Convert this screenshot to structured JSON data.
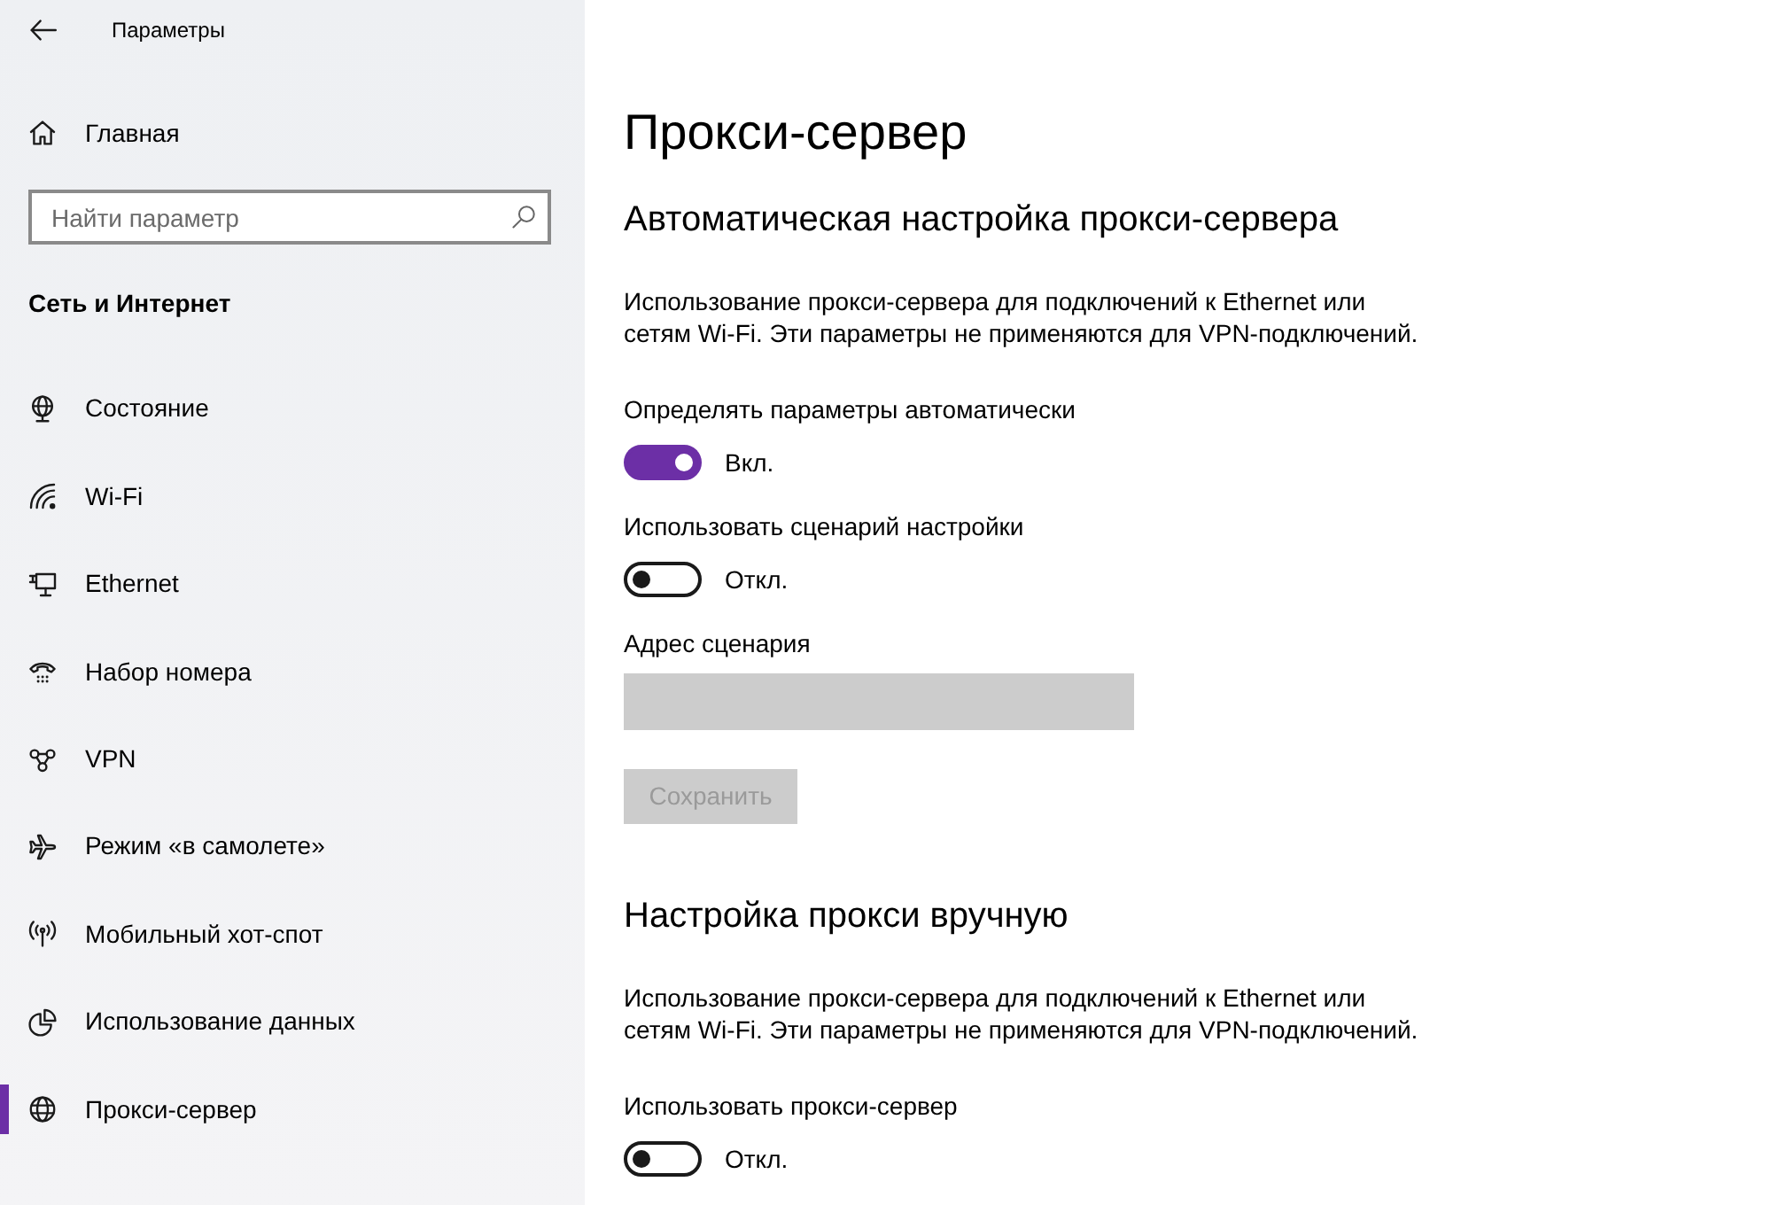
{
  "window": {
    "title": "Параметры"
  },
  "sidebar": {
    "home": {
      "label": "Главная"
    },
    "search": {
      "placeholder": "Найти параметр"
    },
    "section_title": "Сеть и Интернет",
    "items": [
      {
        "label": "Состояние",
        "selected": false
      },
      {
        "label": "Wi-Fi",
        "selected": false
      },
      {
        "label": "Ethernet",
        "selected": false
      },
      {
        "label": "Набор номера",
        "selected": false
      },
      {
        "label": "VPN",
        "selected": false
      },
      {
        "label": "Режим «в самолете»",
        "selected": false
      },
      {
        "label": "Мобильный хот-спот",
        "selected": false
      },
      {
        "label": "Использование данных",
        "selected": false
      },
      {
        "label": "Прокси-сервер",
        "selected": true
      }
    ]
  },
  "page": {
    "title": "Прокси-сервер",
    "sections": [
      {
        "heading": "Автоматическая настройка прокси-сервера",
        "description": "Использование прокси-сервера для подключений к Ethernet или сетям Wi-Fi. Эти параметры не применяются для VPN-подключений.",
        "controls": [
          {
            "kind": "toggle",
            "label": "Определять параметры автоматически",
            "on": true,
            "state_text": "Вкл."
          },
          {
            "kind": "toggle",
            "label": "Использовать сценарий настройки",
            "on": false,
            "state_text": "Откл."
          },
          {
            "kind": "text_field",
            "label": "Адрес сценария",
            "disabled": true
          },
          {
            "kind": "button",
            "label": "Сохранить",
            "disabled": true
          }
        ]
      },
      {
        "heading": "Настройка прокси вручную",
        "description": "Использование прокси-сервера для подключений к Ethernet или сетям Wi-Fi. Эти параметры не применяются для VPN-подключений.",
        "controls": [
          {
            "kind": "toggle",
            "label": "Использовать прокси-сервер",
            "on": false,
            "state_text": "Откл."
          }
        ]
      }
    ]
  }
}
